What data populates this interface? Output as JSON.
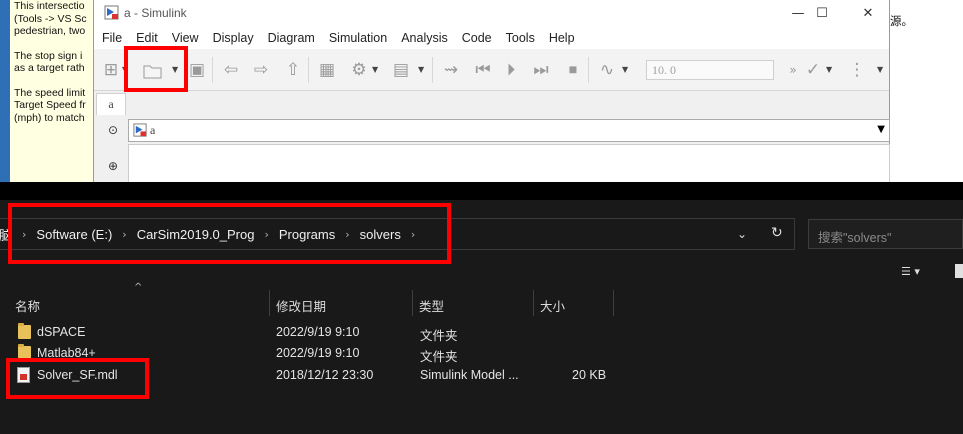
{
  "background": {
    "left_note": [
      "This intersectio\n(Tools -> VS Sc\npedestrian, two",
      "The stop sign i\nas a target rath",
      "The speed limit\nTarget Speed fr\n(mph) to match"
    ],
    "right_text": "源。"
  },
  "simulink": {
    "title": "a - Simulink",
    "window_controls": {
      "minimize": "—",
      "maximize": "☐",
      "close": "✕"
    },
    "menu": [
      "File",
      "Edit",
      "View",
      "Display",
      "Diagram",
      "Simulation",
      "Analysis",
      "Code",
      "Tools",
      "Help"
    ],
    "stop_time": "10. 0",
    "tab_label": "a",
    "address_text": "a"
  },
  "explorer": {
    "breadcrumb": [
      "电脑",
      "Software (E:)",
      "CarSim2019.0_Prog",
      "Programs",
      "solvers"
    ],
    "search_placeholder": "搜索\"solvers\"",
    "columns": {
      "name": "名称",
      "date": "修改日期",
      "type": "类型",
      "size": "大小"
    },
    "files": [
      {
        "name": "dSPACE",
        "date": "2022/9/19 9:10",
        "type": "文件夹",
        "size": "",
        "icon": "folder-icon"
      },
      {
        "name": "Matlab84+",
        "date": "2022/9/19 9:10",
        "type": "文件夹",
        "size": "",
        "icon": "folder-icon"
      },
      {
        "name": "Solver_SF.mdl",
        "date": "2018/12/12 23:30",
        "type": "Simulink Model ...",
        "size": "20 KB",
        "icon": "simulink-model-icon"
      }
    ]
  },
  "colors": {
    "highlight": "#ff0000",
    "explorer_bg": "#191919",
    "note_bg": "#ffffe1",
    "folder": "#e8c15a"
  }
}
